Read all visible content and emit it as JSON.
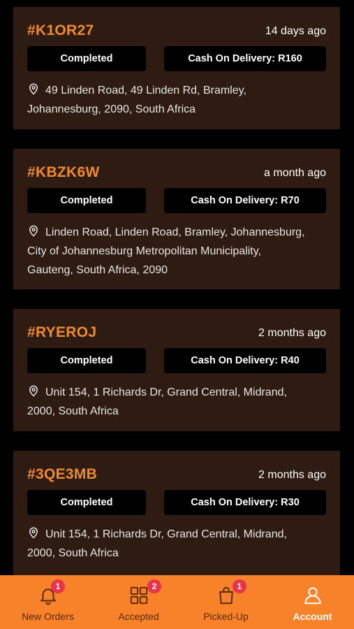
{
  "orders": [
    {
      "id": "#K1OR27",
      "time": "14 days ago",
      "status": "Completed",
      "payment": "Cash On Delivery: R160",
      "address_lines": [
        "49 Linden Road, 49 Linden Rd, Bramley,",
        "Johannesburg, 2090, South Africa"
      ]
    },
    {
      "id": "#KBZK6W",
      "time": "a month ago",
      "status": "Completed",
      "payment": "Cash On Delivery: R70",
      "address_lines": [
        "Linden Road, Linden Road, Bramley, Johannesburg,",
        "City of Johannesburg Metropolitan Municipality,",
        "Gauteng, South Africa, 2090"
      ]
    },
    {
      "id": "#RYEROJ",
      "time": "2 months ago",
      "status": "Completed",
      "payment": "Cash On Delivery: R40",
      "address_lines": [
        "Unit 154, 1 Richards Dr, Grand Central, Midrand,",
        "2000, South Africa"
      ]
    },
    {
      "id": "#3QE3MB",
      "time": "2 months ago",
      "status": "Completed",
      "payment": "Cash On Delivery: R30",
      "address_lines": [
        "Unit 154, 1 Richards Dr, Grand Central, Midrand,",
        "2000, South Africa"
      ]
    }
  ],
  "tabbar": {
    "tabs": [
      {
        "label": "New Orders",
        "badge": "1",
        "icon": "bell-icon"
      },
      {
        "label": "Accepted",
        "badge": "2",
        "icon": "grid-icon"
      },
      {
        "label": "Picked-Up",
        "badge": "1",
        "icon": "shopping-bag-icon"
      },
      {
        "label": "Account",
        "badge": "",
        "icon": "user-icon",
        "active": true
      }
    ]
  },
  "colors": {
    "accent": "#f7822a",
    "order_id": "#f08a2e",
    "card_bg": "#2e1c12",
    "badge": "#e8334a"
  }
}
